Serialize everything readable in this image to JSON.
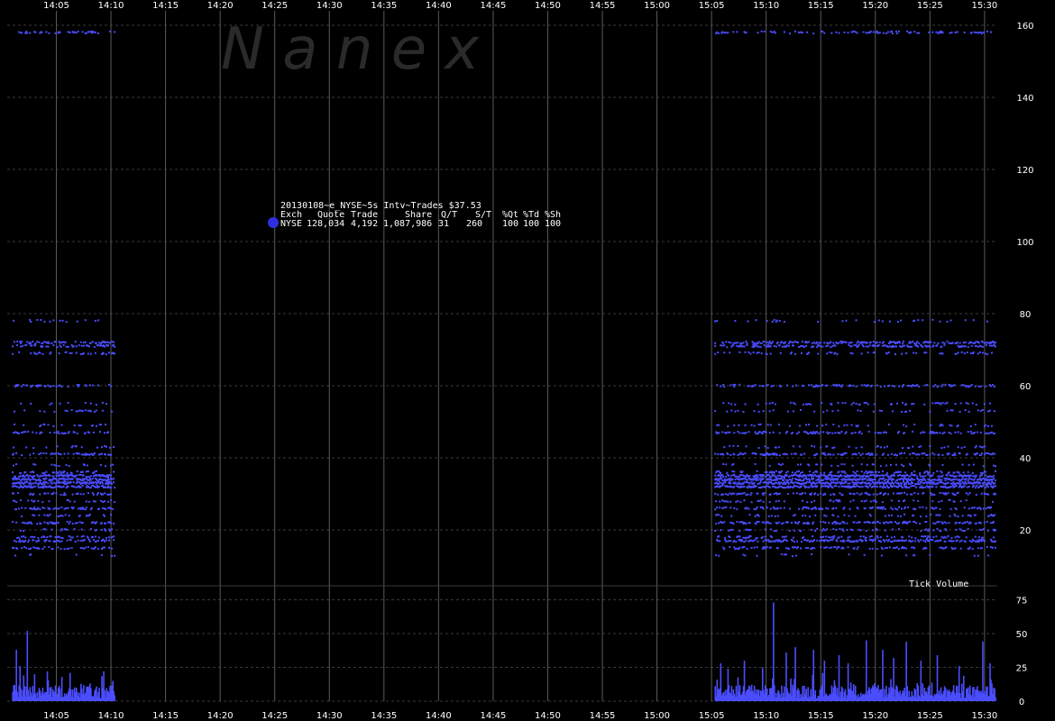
{
  "chart_data": [
    {
      "type": "scatter",
      "title": "",
      "watermark": "N a n e x",
      "colors": {
        "background": "#000000",
        "points": "#4a4dff",
        "legend_dot": "#2f2fe0",
        "grid_major": "#5a5a5a",
        "grid_minor": "#3a3a3a"
      },
      "x_ticks": [
        "14:05",
        "14:10",
        "14:15",
        "14:20",
        "14:25",
        "14:30",
        "14:35",
        "14:40",
        "14:45",
        "14:50",
        "14:55",
        "15:00",
        "15:05",
        "15:10",
        "15:15",
        "15:20",
        "15:25",
        "15:30"
      ],
      "x_range": [
        "14:00:30",
        "15:31:10"
      ],
      "y_ticks": [
        20,
        40,
        60,
        80,
        100,
        120,
        140,
        160
      ],
      "y_range": [
        5,
        164
      ],
      "grid": true,
      "legend": {
        "header": "20130108~e_NYSE~5s Intv~Trades $37.53",
        "columns": [
          "Exch",
          "Quote",
          "Trade",
          "Share",
          "Q/T",
          "S/T",
          "%Qt",
          "%Td",
          "%Sh"
        ],
        "row": [
          "NYSE",
          "128,034",
          "4,192",
          "1,087,986",
          "31",
          "260",
          "100",
          "100",
          "100"
        ],
        "placement": "top-left"
      },
      "series": [
        {
          "segments": [
            [
              "14:01:00",
              "14:10:20"
            ],
            [
              "15:05:20",
              "15:31:00"
            ]
          ],
          "levels": [
            {
              "y": 13,
              "density": 0.08
            },
            {
              "y": 15,
              "density": 0.35
            },
            {
              "y": 17,
              "density": 0.5
            },
            {
              "y": 18,
              "density": 0.25
            },
            {
              "y": 20,
              "density": 0.2
            },
            {
              "y": 22,
              "density": 0.4
            },
            {
              "y": 24,
              "density": 0.2
            },
            {
              "y": 26,
              "density": 0.35
            },
            {
              "y": 28,
              "density": 0.2
            },
            {
              "y": 30,
              "density": 0.35
            },
            {
              "y": 32,
              "density": 0.7
            },
            {
              "y": 33,
              "density": 0.8
            },
            {
              "y": 34,
              "density": 0.85
            },
            {
              "y": 35,
              "density": 0.7
            },
            {
              "y": 36,
              "density": 0.3
            },
            {
              "y": 38,
              "density": 0.15
            },
            {
              "y": 41,
              "density": 0.4
            },
            {
              "y": 43,
              "density": 0.15
            },
            {
              "y": 47,
              "density": 0.35
            },
            {
              "y": 49,
              "density": 0.15
            },
            {
              "y": 53,
              "density": 0.15
            },
            {
              "y": 55,
              "density": 0.15
            },
            {
              "y": 60,
              "density": 0.35
            },
            {
              "y": 69,
              "density": 0.2
            },
            {
              "y": 71,
              "density": 0.5
            },
            {
              "y": 72,
              "density": 0.5
            },
            {
              "y": 78,
              "density": 0.1
            },
            {
              "y": 158,
              "density": 0.3
            }
          ]
        }
      ]
    },
    {
      "type": "bar",
      "title": "Tick Volume",
      "y_ticks": [
        0,
        25,
        50,
        75
      ],
      "y_range": [
        0,
        84
      ],
      "x_range": [
        "14:00:30",
        "15:31:10"
      ],
      "series": [
        {
          "segments": [
            [
              "14:01:00",
              "14:10:20"
            ],
            [
              "15:05:20",
              "15:31:00"
            ]
          ],
          "typical": [
            2,
            12
          ],
          "spikes": [
            {
              "x": "14:01:20",
              "value": 38
            },
            {
              "x": "14:01:40",
              "value": 26
            },
            {
              "x": "14:02:20",
              "value": 52
            },
            {
              "x": "14:03:00",
              "value": 20
            },
            {
              "x": "14:04:10",
              "value": 22
            },
            {
              "x": "14:05:30",
              "value": 18
            },
            {
              "x": "14:09:20",
              "value": 22
            },
            {
              "x": "14:10:10",
              "value": 15
            },
            {
              "x": "15:05:50",
              "value": 28
            },
            {
              "x": "15:06:30",
              "value": 24
            },
            {
              "x": "15:08:00",
              "value": 30
            },
            {
              "x": "15:09:40",
              "value": 25
            },
            {
              "x": "15:10:40",
              "value": 73
            },
            {
              "x": "15:11:50",
              "value": 36
            },
            {
              "x": "15:12:40",
              "value": 40
            },
            {
              "x": "15:14:20",
              "value": 38
            },
            {
              "x": "15:15:20",
              "value": 30
            },
            {
              "x": "15:16:40",
              "value": 34
            },
            {
              "x": "15:17:30",
              "value": 28
            },
            {
              "x": "15:19:10",
              "value": 45
            },
            {
              "x": "15:20:40",
              "value": 38
            },
            {
              "x": "15:21:40",
              "value": 32
            },
            {
              "x": "15:22:50",
              "value": 44
            },
            {
              "x": "15:24:10",
              "value": 30
            },
            {
              "x": "15:25:40",
              "value": 34
            },
            {
              "x": "15:27:40",
              "value": 26
            },
            {
              "x": "15:29:50",
              "value": 44
            },
            {
              "x": "15:30:30",
              "value": 28
            }
          ]
        }
      ]
    }
  ]
}
